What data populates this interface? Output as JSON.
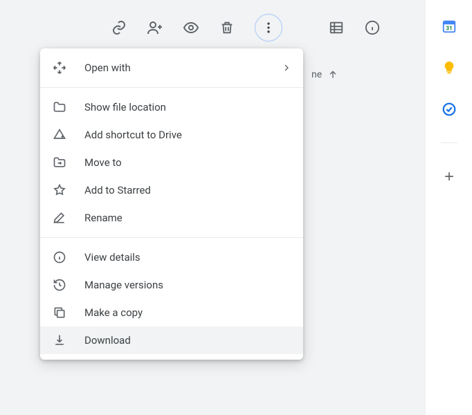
{
  "toolbar": {
    "icons": [
      "link",
      "share-person",
      "preview",
      "delete",
      "more",
      "list-view",
      "info"
    ]
  },
  "content_header": {
    "column_fragment": "ne"
  },
  "menu": {
    "sections": [
      [
        {
          "icon": "open-with",
          "label": "Open with",
          "submenu": true
        }
      ],
      [
        {
          "icon": "folder",
          "label": "Show file location"
        },
        {
          "icon": "drive-shortcut",
          "label": "Add shortcut to Drive"
        },
        {
          "icon": "move-to",
          "label": "Move to"
        },
        {
          "icon": "star",
          "label": "Add to Starred"
        },
        {
          "icon": "rename",
          "label": "Rename"
        }
      ],
      [
        {
          "icon": "info",
          "label": "View details"
        },
        {
          "icon": "versions",
          "label": "Manage versions"
        },
        {
          "icon": "copy",
          "label": "Make a copy"
        },
        {
          "icon": "download",
          "label": "Download",
          "highlight": true
        }
      ]
    ]
  },
  "side_panel": {
    "apps": [
      "calendar",
      "keep",
      "tasks"
    ],
    "add": "add"
  }
}
